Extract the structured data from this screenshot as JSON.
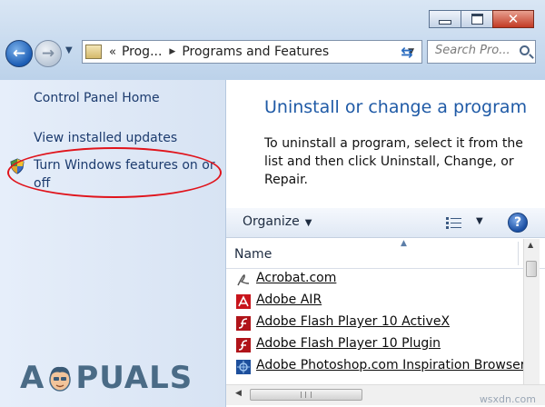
{
  "window": {
    "controls": {
      "minimize": "",
      "maximize": "",
      "close": "✕"
    }
  },
  "nav": {
    "back_glyph": "←",
    "forward_glyph": "→",
    "dropdown_glyph": "▼"
  },
  "address": {
    "overflow": "«",
    "crumbs": [
      "Prog...",
      "Programs and Features"
    ],
    "separator": "▶",
    "dropdown": "▼",
    "refresh_glyph": "⇆"
  },
  "search": {
    "placeholder": "Search Pro..."
  },
  "left_pane": {
    "links": [
      "Control Panel Home",
      "View installed updates",
      "Turn Windows features on or",
      "off"
    ]
  },
  "main": {
    "title": "Uninstall or change a program",
    "description": "To uninstall a program, select it from the list and then click Uninstall, Change, or Repair."
  },
  "toolbar": {
    "organize": "Organize",
    "caret": "▼",
    "views_dropdown": "▼",
    "help": "?"
  },
  "list": {
    "sort_arrow": "▲",
    "column_name": "Name",
    "rows": [
      {
        "label": "Acrobat.com",
        "icon": "acrobat-icon"
      },
      {
        "label": "Adobe AIR",
        "icon": "adobe-air-icon"
      },
      {
        "label": "Adobe Flash Player 10 ActiveX",
        "icon": "flash-player-icon"
      },
      {
        "label": "Adobe Flash Player 10 Plugin",
        "icon": "flash-player-icon"
      },
      {
        "label": "Adobe Photoshop.com Inspiration Browser",
        "icon": "photoshop-icon"
      }
    ]
  },
  "scrollbars": {
    "up": "▲",
    "left": "◀"
  },
  "watermark": {
    "logo_text": "APPUALS",
    "logo_left": "A",
    "logo_right": "PUALS",
    "site": "wsxdn.com"
  },
  "colors": {
    "title_blue": "#1f5aa6",
    "link_blue": "#1c3b6e",
    "highlight_oval": "#e0141c",
    "close_red": "#c23a24"
  }
}
